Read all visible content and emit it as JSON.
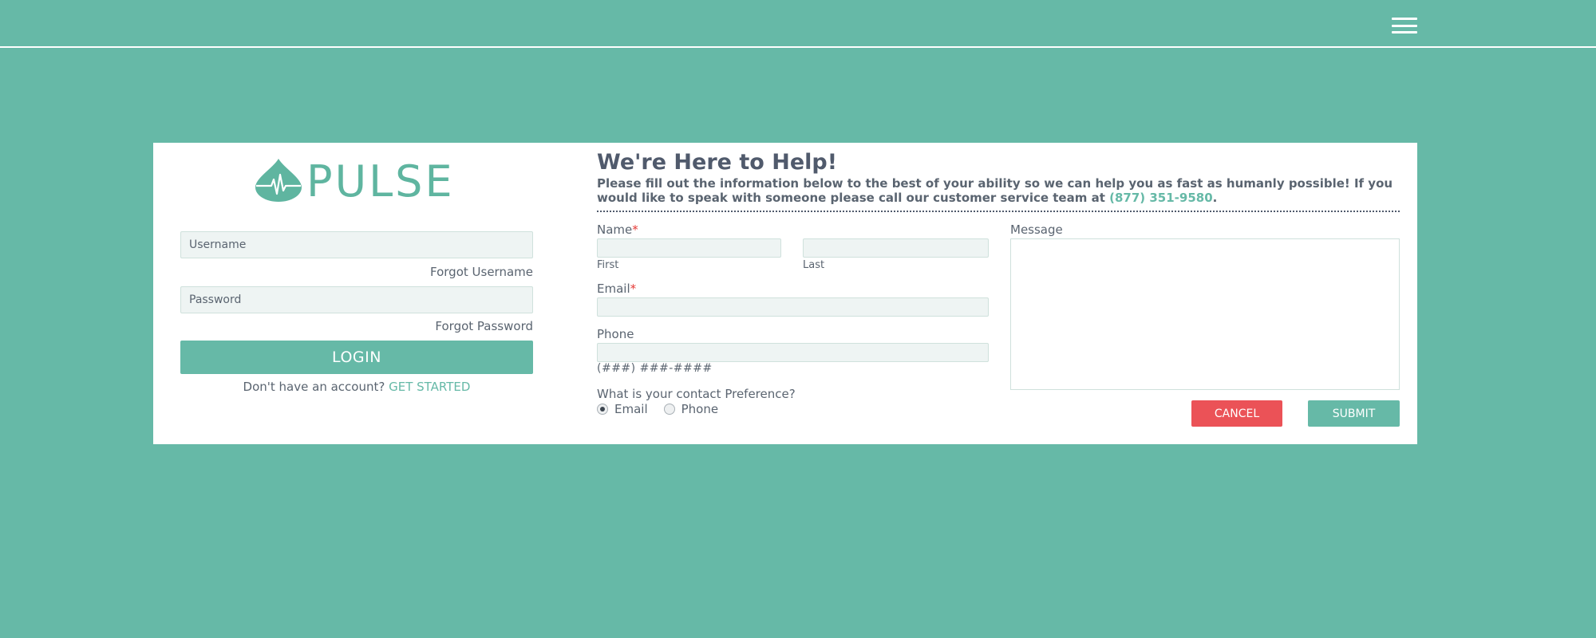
{
  "header": {
    "menu_icon": "hamburger-menu-icon"
  },
  "login": {
    "logo_icon": "drop-heartbeat-icon",
    "logo_text": "PULSE",
    "username_placeholder": "Username",
    "forgot_username": "Forgot Username",
    "password_placeholder": "Password",
    "forgot_password": "Forgot Password",
    "login_button": "LOGIN",
    "signup_prompt": "Don't have an account?",
    "signup_link": "GET STARTED"
  },
  "contact": {
    "title": "We're Here to Help!",
    "intro": "Please fill out the information below to the best of your ability so we can help you as fast as humanly possible! If you would like to speak with someone please call our customer service team at",
    "phone": "(877) 351-9580",
    "intro_end": ".",
    "name_label": "Name",
    "first_label": "First",
    "last_label": "Last",
    "email_label": "Email",
    "phone_label": "Phone",
    "phone_hint": "(###) ###-####",
    "preference_label": "What is your contact Preference?",
    "preference_options": [
      "Email",
      "Phone"
    ],
    "preference_selected": "Email",
    "message_label": "Message",
    "required_mark": "*",
    "cancel_button": "CANCEL",
    "submit_button": "SUBMIT"
  },
  "colors": {
    "background": "#66b9a7",
    "brand": "#66b9a7",
    "cancel": "#eb5257",
    "required": "#e53935",
    "heading": "#505a6c"
  }
}
